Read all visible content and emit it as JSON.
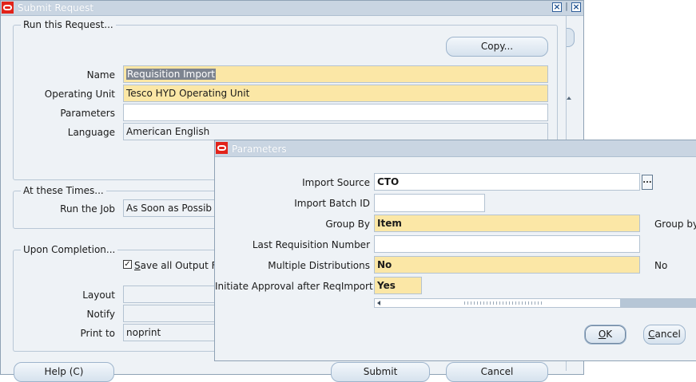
{
  "submit_window": {
    "title": "Submit Request",
    "group_run": "Run this Request...",
    "copy_button": "Copy...",
    "name_label": "Name",
    "name_value": "Requisition Import",
    "ou_label": "Operating Unit",
    "ou_value": "Tesco HYD Operating Unit",
    "params_label": "Parameters",
    "params_value": "",
    "lang_label": "Language",
    "lang_value": "American English",
    "group_times": "At these Times...",
    "runjob_label": "Run the Job",
    "runjob_value": "As Soon as Possib",
    "group_completion": "Upon Completion...",
    "save_output_label_rest": "ave all Output F",
    "save_output_underline": "S",
    "save_output_checked": true,
    "layout_label": "Layout",
    "notify_label": "Notify",
    "printto_label": "Print to",
    "printto_value": "noprint",
    "help_button": "Help (C)",
    "submit_button": "Submit",
    "cancel_button": "Cancel"
  },
  "params_window": {
    "title": "Parameters",
    "import_source_label": "Import Source",
    "import_source_value": "CTO",
    "import_batch_label": "Import Batch ID",
    "import_batch_value": "",
    "group_by_label": "Group By",
    "group_by_value": "Item",
    "group_by_desc": "Group by",
    "last_req_label": "Last Requisition Number",
    "last_req_value": "",
    "multi_dist_label": "Multiple Distributions",
    "multi_dist_value": "No",
    "multi_dist_desc": "No",
    "initiate_label": "Initiate Approval after ReqImport",
    "initiate_value": "Yes",
    "ok_button_underline": "O",
    "ok_button_rest": "K",
    "cancel_button_underline": "C",
    "cancel_button_rest": "ancel",
    "lov_button": "..."
  },
  "colors": {
    "required_field": "#fbe7a6",
    "window_bg": "#eef2f6",
    "titlebar": "#c9d5e2",
    "oracle_red": "#e2231a"
  }
}
